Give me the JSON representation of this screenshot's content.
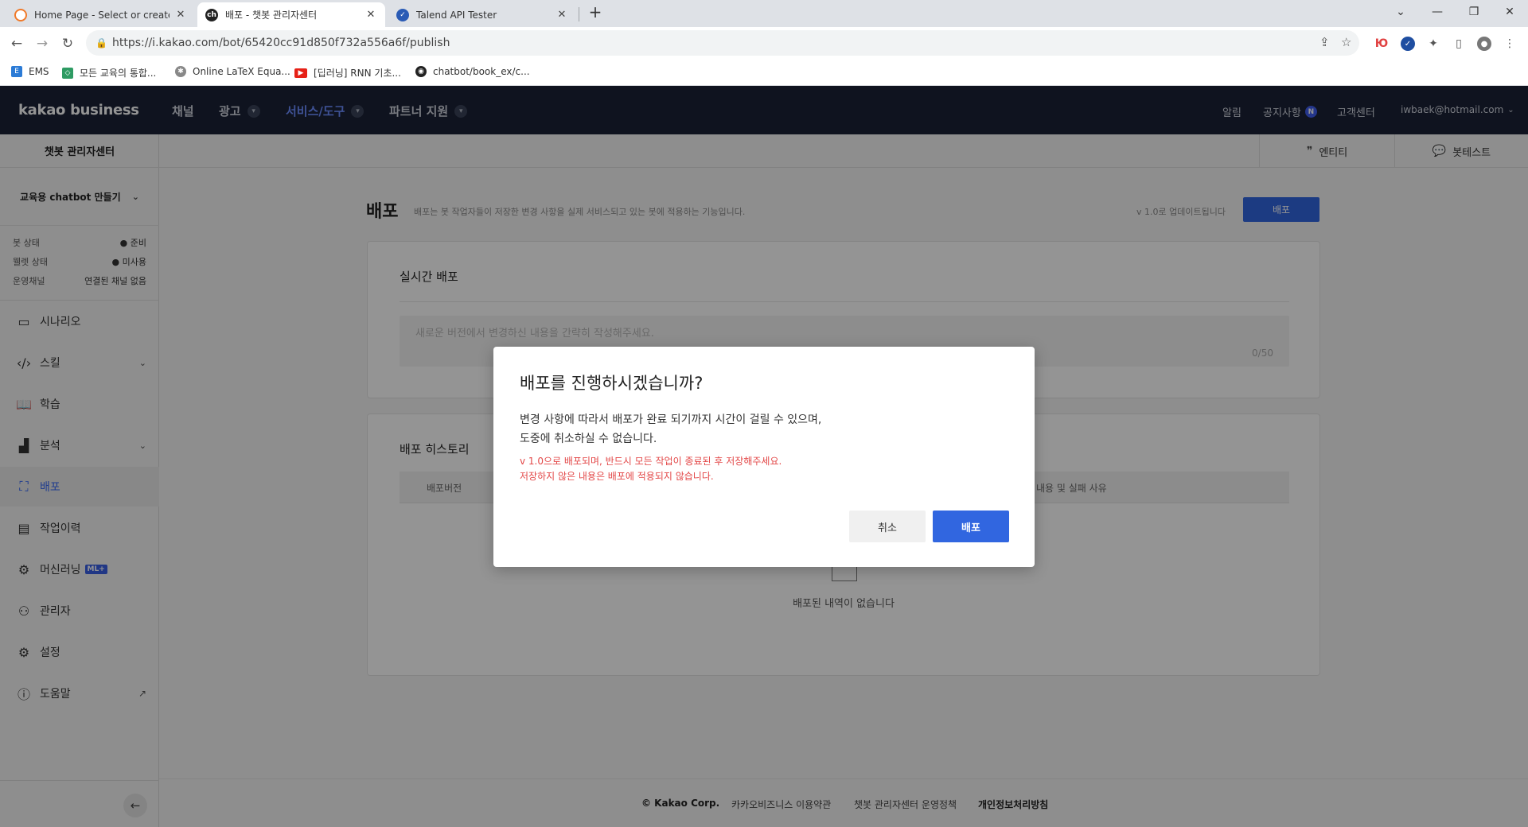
{
  "browser": {
    "tabs": [
      {
        "title": "Home Page - Select or create a"
      },
      {
        "title": "배포 - 챗봇 관리자센터"
      },
      {
        "title": "Talend API Tester"
      }
    ],
    "url": "https://i.kakao.com/bot/65420cc91d850f732a556a6f/publish",
    "bookmarks": [
      {
        "label": "EMS"
      },
      {
        "label": "모든 교육의 통합..."
      },
      {
        "label": "Online LaTeX Equa..."
      },
      {
        "label": "[딥러닝] RNN 기초..."
      },
      {
        "label": "chatbot/book_ex/c..."
      }
    ]
  },
  "header": {
    "logo": "kakao business",
    "nav": [
      {
        "label": "채널"
      },
      {
        "label": "광고"
      },
      {
        "label": "서비스/도구"
      },
      {
        "label": "파트너 지원"
      }
    ],
    "right": {
      "alarm": "알림",
      "notice": "공지사항",
      "notice_badge": "N",
      "support": "고객센터",
      "account": "iwbaek@hotmail.com"
    }
  },
  "sidebar": {
    "title": "챗봇 관리자센터",
    "bot_name": "교육용 chatbot 만들기",
    "status": [
      {
        "label": "봇 상태",
        "value": "● 준비"
      },
      {
        "label": "웰렛 상태",
        "value": "● 미사용"
      },
      {
        "label": "운영채널",
        "value": "연결된 채널 없음"
      }
    ],
    "menu": [
      {
        "label": "시나리오"
      },
      {
        "label": "스킬"
      },
      {
        "label": "학습"
      },
      {
        "label": "분석"
      },
      {
        "label": "배포"
      },
      {
        "label": "작업이력"
      },
      {
        "label": "머신러닝"
      },
      {
        "label": "관리자"
      },
      {
        "label": "설정"
      },
      {
        "label": "도움말"
      }
    ],
    "ml_badge": "ML+"
  },
  "subheader": {
    "entity": "엔티티",
    "bot_test": "봇테스트"
  },
  "main": {
    "title": "배포",
    "description": "배포는 봇 작업자들이 저장한 변경 사항을 실제 서비스되고 있는 봇에 적용하는 기능입니다.",
    "version_note": "v 1.0로 업데이트됩니다",
    "publish_button": "배포",
    "realtime": {
      "title": "실시간 배포",
      "placeholder": "새로운 버전에서 변경하신 내용을 간략히 작성해주세요.",
      "count": "0/50"
    },
    "history": {
      "title": "배포 히스토리",
      "col_version": "배포버전",
      "col_reason": "내용 및 실패 사유",
      "empty": "배포된 내역이 없습니다"
    }
  },
  "footer": {
    "copyright": "© Kakao Corp.",
    "terms": "카카오비즈니스 이용약관",
    "policy": "챗봇 관리자센터 운영정책",
    "privacy": "개인정보처리방침"
  },
  "modal": {
    "title": "배포를 진행하시겠습니까?",
    "body_line1": "변경 사항에 따라서 배포가 완료 되기까지 시간이 걸릴 수 있으며,",
    "body_line2": "도중에 취소하실 수 없습니다.",
    "warn_line1": "v 1.0으로 배포되며, 반드시 모든 작업이 종료된 후 저장해주세요.",
    "warn_line2": "저장하지 않은 내용은 배포에 적용되지 않습니다.",
    "cancel": "취소",
    "confirm": "배포"
  },
  "colors": {
    "header_bg": "#1a2236",
    "accent": "#3166e0",
    "warning": "#e34848"
  }
}
